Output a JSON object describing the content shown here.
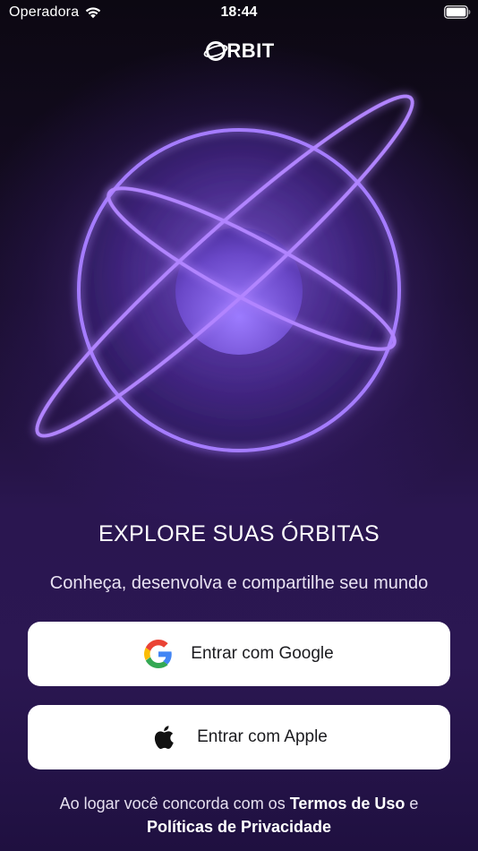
{
  "status_bar": {
    "carrier": "Operadora",
    "time": "18:44",
    "icons": [
      "wifi-icon",
      "battery-icon"
    ]
  },
  "brand": {
    "logo_text": "RBIT",
    "logo_icon": "orbit-logo-icon"
  },
  "hero": {
    "illustration": "planet-orbit-illustration",
    "title": "EXPLORE SUAS ÓRBITAS",
    "subtitle": "Conheça, desenvolva e compartilhe seu mundo"
  },
  "auth": {
    "google_label": "Entrar com Google",
    "google_icon": "google-icon",
    "apple_label": "Entrar com Apple",
    "apple_icon": "apple-icon"
  },
  "legal": {
    "prefix": "Ao logar você concorda com os ",
    "terms_label": "Termos de Uso",
    "conjunction": " e",
    "privacy_label": "Políticas de Privacidade"
  },
  "colors": {
    "background_top": "#0c0812",
    "background_bottom": "#2b1752",
    "glow": "#9b6bff",
    "button_bg": "#ffffff",
    "button_text": "#1b1b1f"
  }
}
